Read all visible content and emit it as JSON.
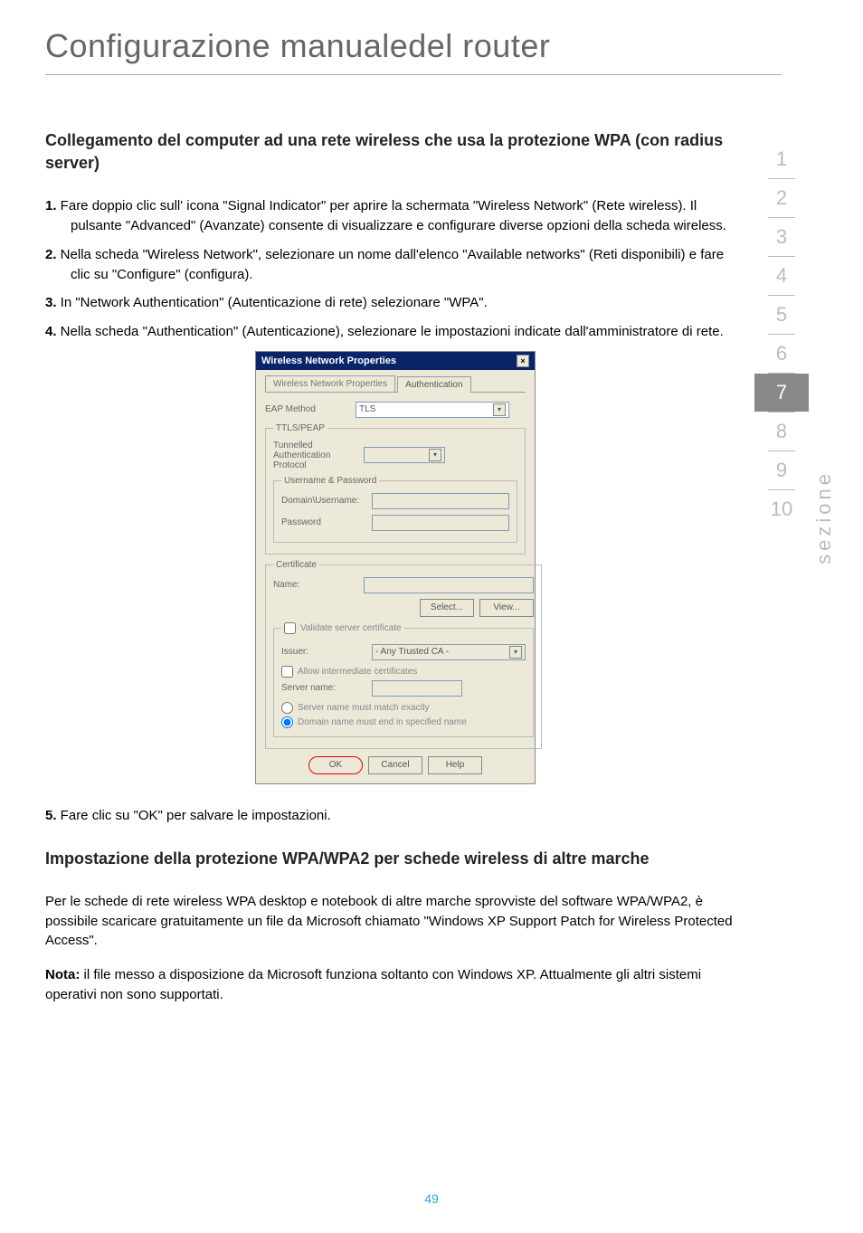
{
  "page_title": "Configurazione manualedel router",
  "heading1": "Collegamento del computer ad una rete wireless che usa la protezione WPA (con radius server)",
  "steps1": [
    {
      "n": "1.",
      "text": " Fare doppio clic sull' icona \"Signal Indicator\" per aprire la schermata \"Wireless Network\" (Rete wireless). Il pulsante \"Advanced\" (Avanzate) consente di visualizzare e configurare diverse opzioni della scheda wireless."
    },
    {
      "n": "2.",
      "text": " Nella scheda \"Wireless Network\", selezionare un nome dall'elenco \"Available networks\" (Reti disponibili) e fare clic su \"Configure\" (configura)."
    },
    {
      "n": "3.",
      "text": " In \"Network Authentication\" (Autenticazione di rete) selezionare \"WPA\"."
    },
    {
      "n": "4.",
      "text": " Nella scheda \"Authentication\" (Autenticazione), selezionare le impostazioni indicate dall'amministratore di rete."
    }
  ],
  "dialog": {
    "title": "Wireless Network Properties",
    "tab1": "Wireless Network Properties",
    "tab2": "Authentication",
    "eap_label": "EAP Method",
    "eap_value": "TLS",
    "ttls_legend": "TTLS/PEAP",
    "tunnelled_label": "Tunnelled Authentication Protocol",
    "user_legend": "Username & Password",
    "domain_label": "Domain\\Username:",
    "password_label": "Password",
    "cert_legend": "Certificate",
    "name_label": "Name:",
    "select_btn": "Select...",
    "view_btn": "View...",
    "validate_label": "Validate server certificate",
    "issuer_label": "Issuer:",
    "issuer_value": "- Any Trusted CA -",
    "allow_label": "Allow intermediate certificates",
    "server_label": "Server name:",
    "radio1": "Server name must match exactly",
    "radio2": "Domain name must end in specified name",
    "ok": "OK",
    "cancel": "Cancel",
    "help": "Help"
  },
  "step5": {
    "n": "5.",
    "text": " Fare clic su \"OK\" per salvare le impostazioni."
  },
  "heading2": "Impostazione della protezione WPA/WPA2 per schede wireless di altre marche",
  "para1": "Per le schede di rete wireless WPA desktop e notebook di altre marche sprovviste del software WPA/WPA2, è possibile scaricare gratuitamente un file da Microsoft chiamato \"Windows XP Support Patch for Wireless Protected Access\".",
  "nota_label": "Nota:",
  "para2": "  il file messo a disposizione da Microsoft funziona soltanto con Windows XP. Attualmente gli altri sistemi operativi non sono supportati.",
  "nav": [
    "1",
    "2",
    "3",
    "4",
    "5",
    "6",
    "7",
    "8",
    "9",
    "10"
  ],
  "nav_active": 6,
  "vertical_label": "sezione",
  "page_number": "49"
}
